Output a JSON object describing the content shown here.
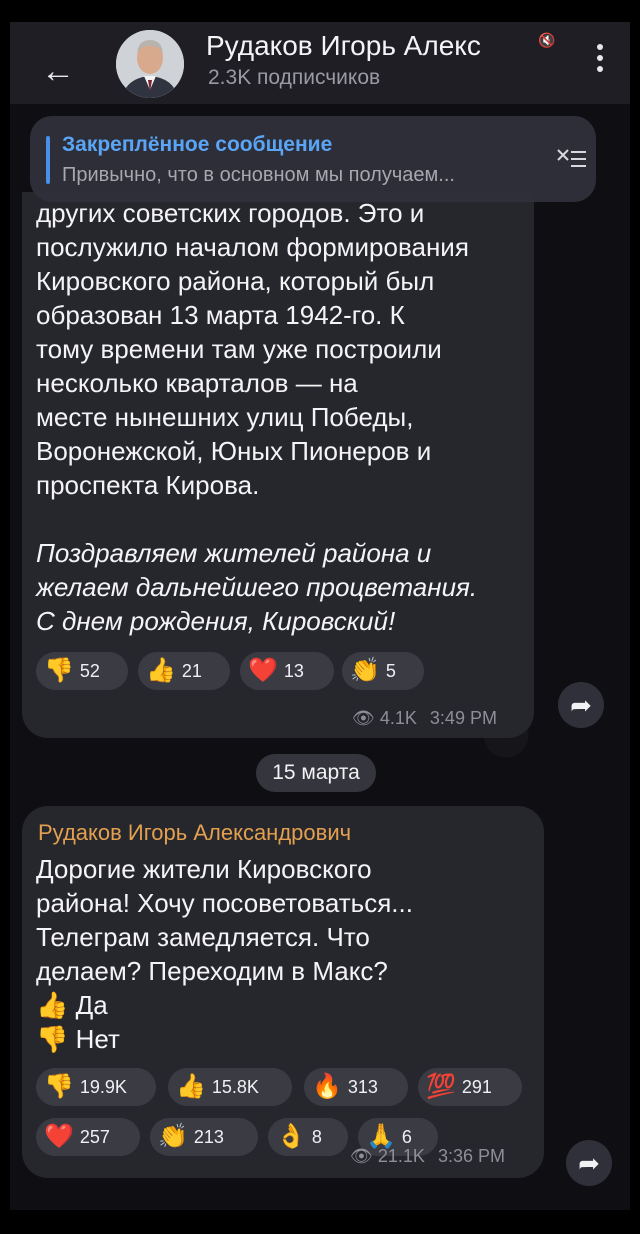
{
  "header": {
    "back_icon": "arrow-left-icon",
    "title": "Рудаков Игорь Алекс",
    "subtitle": "2.3K подписчиков",
    "menu_icon": "more-vertical-icon"
  },
  "pinned": {
    "title": "Закреплённое сообщение",
    "preview": "Привычно, что в основном мы получаем...",
    "icon": "unpin-list-icon"
  },
  "post1": {
    "lines": [
      "других советских городов. Это и",
      "послужило началом формирования",
      "Кировского района, который был",
      "образован 13 марта 1942-го. К",
      "тому времени там уже построили",
      "несколько кварталов — на",
      "месте нынешних улиц Победы,",
      "Воронежской, Юных Пионеров и",
      "проспекта Кирова."
    ],
    "italic_lines": [
      "Поздравляем жителей района и",
      "желаем дальнейшего процветания.",
      "С днем рождения, Кировский!"
    ],
    "reactions": [
      {
        "emoji": "👎",
        "count": "52"
      },
      {
        "emoji": "👍",
        "count": "21"
      },
      {
        "emoji": "❤️",
        "count": "13"
      },
      {
        "emoji": "👏",
        "count": "5"
      }
    ],
    "views": "4.1K",
    "time": "3:49 PM"
  },
  "date_separator": "15 марта",
  "post2": {
    "author": "Рудаков Игорь Александрович",
    "lines": [
      "Дорогие жители Кировского",
      "района! Хочу посоветоваться...",
      "Телеграм замедляется. Что",
      "делаем? Переходим в Макс?"
    ],
    "options": [
      {
        "emoji": "👍",
        "label": "Да"
      },
      {
        "emoji": "👎",
        "label": "Нет"
      }
    ],
    "reactions_row1": [
      {
        "emoji": "👎",
        "count": "19.9K"
      },
      {
        "emoji": "👍",
        "count": "15.8K"
      },
      {
        "emoji": "🔥",
        "count": "313"
      },
      {
        "emoji": "💯",
        "count": "291"
      }
    ],
    "reactions_row2": [
      {
        "emoji": "❤️",
        "count": "257"
      },
      {
        "emoji": "👏",
        "count": "213"
      },
      {
        "emoji": "👌",
        "count": "8"
      },
      {
        "emoji": "🙏",
        "count": "6"
      }
    ],
    "views": "21.1K",
    "time": "3:36 PM"
  },
  "colors": {
    "accent_link": "#5aa5f5",
    "author_name": "#e3a04f",
    "bubble": "#26262d",
    "background": "#0f0f13"
  }
}
